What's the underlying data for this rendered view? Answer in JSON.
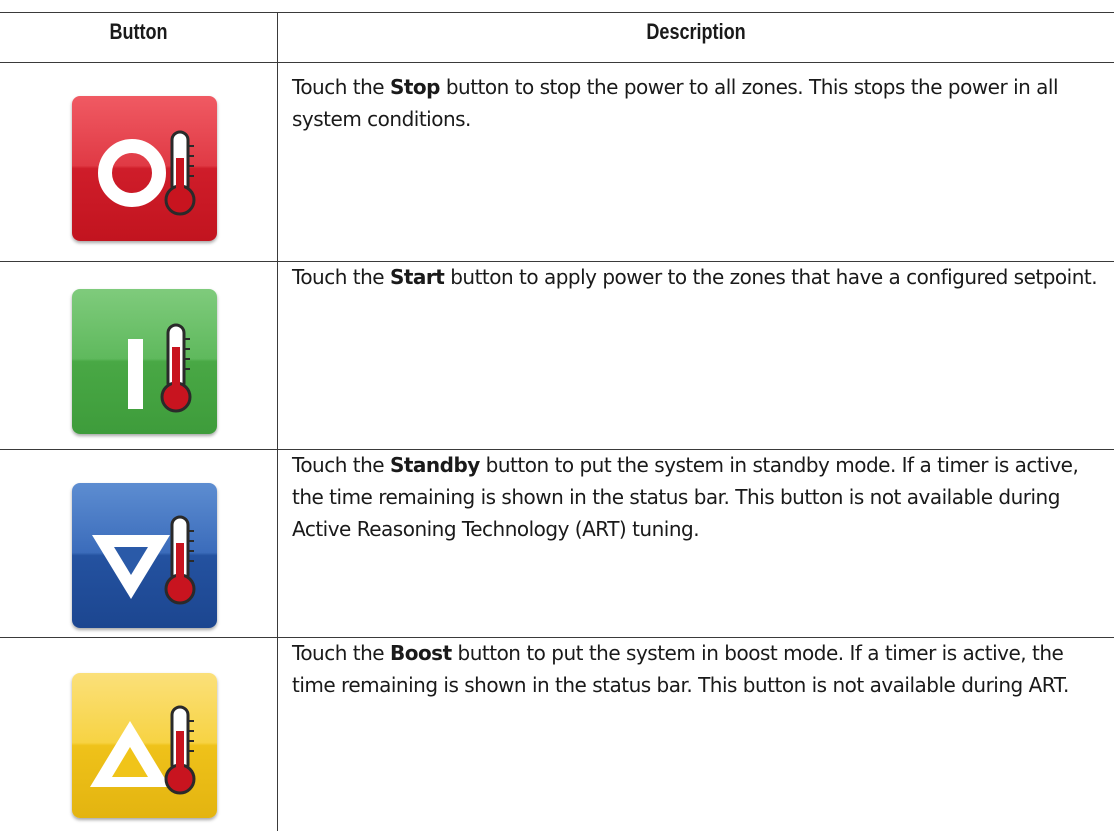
{
  "table": {
    "header": {
      "button": "Button",
      "description": "Description"
    },
    "rows": [
      {
        "icon": "stop-icon",
        "color": "#d42a35",
        "pre": "Touch the ",
        "bold": "Stop",
        "post": " button to stop the power to all zones. This stops the power in all system conditions."
      },
      {
        "icon": "start-icon",
        "color": "#4eae4f",
        "pre": "Touch the ",
        "bold": "Start",
        "post": " button to apply power to the zones that have a configured setpoint."
      },
      {
        "icon": "standby-icon",
        "color": "#2a5aa8",
        "pre": "Touch the ",
        "bold": "Standby",
        "post": " button to put the system in standby mode. If a timer is active, the time remaining is shown in the status bar. This button is not available during Active Reasoning Technology (ART) tuning."
      },
      {
        "icon": "boost-icon",
        "color": "#f0c419",
        "pre": "Touch the ",
        "bold": "Boost",
        "post": " button to put the system in boost mode. If a timer is active, the time remaining is shown in the status bar. This button is not available during ART."
      }
    ]
  }
}
